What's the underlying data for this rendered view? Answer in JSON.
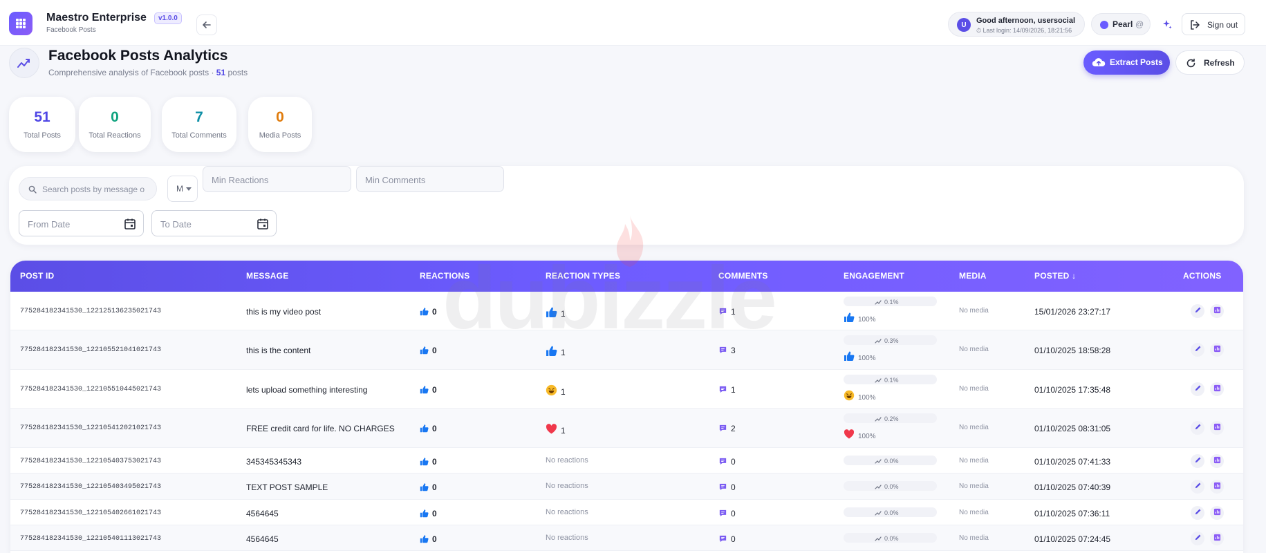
{
  "app": {
    "title": "Maestro Enterprise",
    "version": "v1.0.0",
    "subtitle": "Facebook Posts"
  },
  "user": {
    "avatar_letter": "U",
    "greeting": "Good afternoon, usersocial",
    "last_login": "Last login: 14/09/2026, 18:21:56",
    "persona": "Pearl",
    "persona_suffix": "@",
    "signout_label": "Sign out"
  },
  "page": {
    "title": "Facebook Posts Analytics",
    "subtitle_prefix": "Comprehensive analysis of Facebook posts · ",
    "subtitle_count": "51",
    "subtitle_suffix": " posts",
    "extract_label": "Extract Posts",
    "refresh_label": "Refresh"
  },
  "stats": [
    {
      "value": "51",
      "label": "Total Posts",
      "color": "#4f46e5"
    },
    {
      "value": "0",
      "label": "Total Reactions",
      "color": "#10a37f"
    },
    {
      "value": "7",
      "label": "Total Comments",
      "color": "#0e8fa6"
    },
    {
      "value": "0",
      "label": "Media Posts",
      "color": "#e07b0b"
    }
  ],
  "filters": {
    "search_placeholder": "Search posts by message o",
    "media_value": "M",
    "min_reactions_placeholder": "Min Reactions",
    "min_comments_placeholder": "Min Comments",
    "from_date_placeholder": "From Date",
    "to_date_placeholder": "To Date"
  },
  "table": {
    "columns": [
      "POST ID",
      "MESSAGE",
      "REACTIONS",
      "REACTION TYPES",
      "COMMENTS",
      "ENGAGEMENT",
      "MEDIA",
      "POSTED",
      "ACTIONS"
    ],
    "rows": [
      {
        "post_id": "775284182341530_122125136235021743",
        "message": "this is my video post",
        "reactions": "0",
        "reaction_type": "like",
        "reaction_count": "1",
        "comments": "1",
        "engagement_pct": "0.1%",
        "engagement_type": "like",
        "engagement_share": "100%",
        "media": "No media",
        "posted": "15/01/2026 23:27:17"
      },
      {
        "post_id": "775284182341530_122105521041021743",
        "message": "this is the content",
        "reactions": "0",
        "reaction_type": "like",
        "reaction_count": "1",
        "comments": "3",
        "engagement_pct": "0.3%",
        "engagement_type": "like",
        "engagement_share": "100%",
        "media": "No media",
        "posted": "01/10/2025 18:58:28"
      },
      {
        "post_id": "775284182341530_122105510445021743",
        "message": "lets upload something interesting",
        "reactions": "0",
        "reaction_type": "haha",
        "reaction_count": "1",
        "comments": "1",
        "engagement_pct": "0.1%",
        "engagement_type": "haha",
        "engagement_share": "100%",
        "media": "No media",
        "posted": "01/10/2025 17:35:48"
      },
      {
        "post_id": "775284182341530_122105412021021743",
        "message": "FREE credit card for life. NO CHARGES",
        "reactions": "0",
        "reaction_type": "love",
        "reaction_count": "1",
        "comments": "2",
        "engagement_pct": "0.2%",
        "engagement_type": "love",
        "engagement_share": "100%",
        "media": "No media",
        "posted": "01/10/2025 08:31:05"
      },
      {
        "post_id": "775284182341530_122105403753021743",
        "message": "345345345343",
        "reactions": "0",
        "reaction_type": "",
        "reaction_count": "No reactions",
        "comments": "0",
        "engagement_pct": "0.0%",
        "engagement_type": "",
        "engagement_share": "",
        "media": "No media",
        "posted": "01/10/2025 07:41:33"
      },
      {
        "post_id": "775284182341530_122105403495021743",
        "message": "TEXT POST SAMPLE",
        "reactions": "0",
        "reaction_type": "",
        "reaction_count": "No reactions",
        "comments": "0",
        "engagement_pct": "0.0%",
        "engagement_type": "",
        "engagement_share": "",
        "media": "No media",
        "posted": "01/10/2025 07:40:39"
      },
      {
        "post_id": "775284182341530_122105402661021743",
        "message": "4564645",
        "reactions": "0",
        "reaction_type": "",
        "reaction_count": "No reactions",
        "comments": "0",
        "engagement_pct": "0.0%",
        "engagement_type": "",
        "engagement_share": "",
        "media": "No media",
        "posted": "01/10/2025 07:36:11"
      },
      {
        "post_id": "775284182341530_122105401113021743",
        "message": "4564645",
        "reactions": "0",
        "reaction_type": "",
        "reaction_count": "No reactions",
        "comments": "0",
        "engagement_pct": "0.0%",
        "engagement_type": "",
        "engagement_share": "",
        "media": "No media",
        "posted": "01/10/2025 07:24:45"
      }
    ]
  },
  "watermark": {
    "text": "dubizzle"
  },
  "colors": {
    "accent": "#5b4ee6",
    "like": "#1877f2",
    "love": "#f0384b",
    "haha": "#f7b928"
  },
  "icons": {
    "logo": "grid-icon",
    "back": "arrow-left-icon",
    "sparkle": "sparkle-icon",
    "signout": "logout-icon",
    "analytics": "trend-icon",
    "extract": "cloud-upload-icon",
    "refresh": "refresh-icon",
    "search": "search-icon",
    "calendar": "calendar-icon",
    "comment": "comment-icon",
    "edit": "pencil-icon",
    "analytics_row": "chart-icon"
  }
}
